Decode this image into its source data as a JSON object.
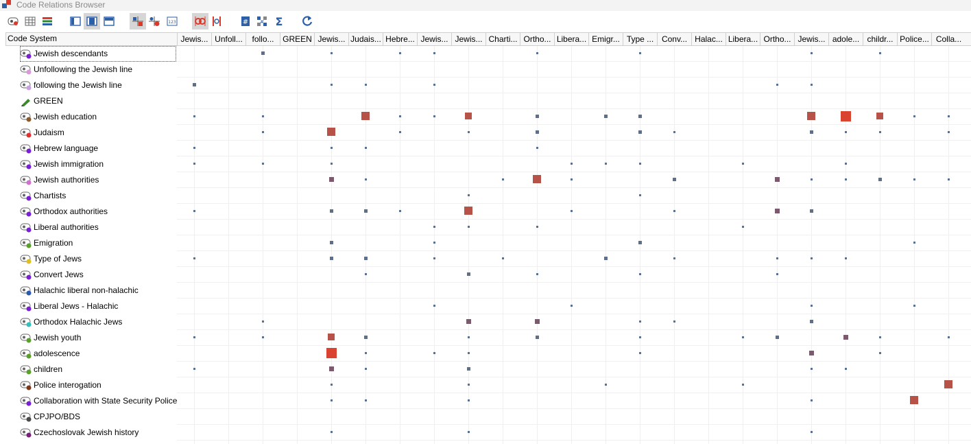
{
  "window": {
    "title": "Code Relations Browser"
  },
  "colors": {
    "small": "#5b6f8e",
    "medium": "#7b5a6e",
    "large": "#b75248",
    "largest": "#d9432f"
  },
  "toolbar": {
    "buttons": [
      {
        "name": "codes-icon",
        "active": false
      },
      {
        "name": "table-icon",
        "active": false
      },
      {
        "name": "list-colors-icon",
        "active": false
      },
      {
        "name": "layout-left-icon",
        "active": false
      },
      {
        "name": "layout-center-icon",
        "active": true
      },
      {
        "name": "layout-top-icon",
        "active": false
      },
      {
        "name": "squares-view-icon",
        "active": true
      },
      {
        "name": "circles-view-icon",
        "active": false
      },
      {
        "name": "numbers-view-icon",
        "active": false
      },
      {
        "name": "intersection-icon",
        "active": true
      },
      {
        "name": "proximity-icon",
        "active": false
      },
      {
        "name": "hash-icon",
        "active": false
      },
      {
        "name": "grid-hash-icon",
        "active": false
      },
      {
        "name": "sigma-icon",
        "active": false
      },
      {
        "name": "refresh-icon",
        "active": false
      }
    ]
  },
  "header": {
    "code_system": "Code System",
    "columns": [
      "Jewis...",
      "Unfoll...",
      "follo...",
      "GREEN",
      "Jewis...",
      "Judais...",
      "Hebre...",
      "Jewis...",
      "Jewis...",
      "Charti...",
      "Ortho...",
      "Libera...",
      "Emigr...",
      "Type ...",
      "Conv...",
      "Halac...",
      "Libera...",
      "Ortho...",
      "Jewis...",
      "adole...",
      "childr...",
      "Police...",
      "Colla..."
    ]
  },
  "rows": [
    {
      "label": "Jewish descendants",
      "dot": "#7a1fd6",
      "icon": "code",
      "cells": {
        "2": 2,
        "4": 1,
        "6": 1,
        "7": 1,
        "10": 1,
        "13": 1,
        "18": 1,
        "20": 1
      }
    },
    {
      "label": "Unfollowing the Jewish line",
      "dot": "#d89ad8",
      "icon": "code",
      "cells": {}
    },
    {
      "label": "following the Jewish line",
      "dot": "#c9a0e0",
      "icon": "code",
      "cells": {
        "0": 2,
        "4": 1,
        "5": 1,
        "7": 1,
        "17": 1,
        "18": 1
      }
    },
    {
      "label": "GREEN",
      "dot": "#3a8a2a",
      "icon": "pencil",
      "cells": {}
    },
    {
      "label": "Jewish education",
      "dot": "#8a5a2a",
      "icon": "code",
      "cells": {
        "0": 1,
        "2": 1,
        "5": "L",
        "6": 1,
        "7": 1,
        "8": "M",
        "10": 2,
        "12": 2,
        "13": 2,
        "18": "L",
        "19": "X",
        "20": "M",
        "21": 1,
        "22": 1
      }
    },
    {
      "label": "Judaism",
      "dot": "#e03030",
      "icon": "code",
      "cells": {
        "2": 1,
        "4": "L",
        "6": 1,
        "8": 1,
        "10": 2,
        "13": 2,
        "14": 1,
        "18": 2,
        "19": 1,
        "20": 1,
        "22": 1
      }
    },
    {
      "label": "Hebrew language",
      "dot": "#7a1fd6",
      "icon": "code",
      "cells": {
        "0": 1,
        "4": 1,
        "5": 1,
        "10": 1
      }
    },
    {
      "label": "Jewish immigration",
      "dot": "#7a1fd6",
      "icon": "code",
      "cells": {
        "0": 1,
        "2": 1,
        "4": 1,
        "11": 1,
        "12": 1,
        "13": 1,
        "16": 1,
        "19": 1
      }
    },
    {
      "label": "Jewish authorities",
      "dot": "#d070d0",
      "icon": "code",
      "cells": {
        "4": "S",
        "5": 1,
        "9": 1,
        "10": "L",
        "11": 1,
        "14": 2,
        "17": "S",
        "18": 1,
        "19": 1,
        "20": 2,
        "21": 1,
        "22": 1
      }
    },
    {
      "label": "Chartists",
      "dot": "#7a1fd6",
      "icon": "code",
      "cells": {
        "8": 1,
        "13": 1
      }
    },
    {
      "label": "Orthodox authorities",
      "dot": "#7a1fd6",
      "icon": "code",
      "cells": {
        "0": 1,
        "4": 2,
        "5": 2,
        "6": 1,
        "8": "L",
        "11": 1,
        "14": 1,
        "17": "S",
        "18": 2
      }
    },
    {
      "label": "Liberal authorities",
      "dot": "#7a1fd6",
      "icon": "code",
      "cells": {
        "7": 1,
        "8": 1,
        "10": 1,
        "16": 1
      }
    },
    {
      "label": "Emigration",
      "dot": "#5aa02a",
      "icon": "code",
      "cells": {
        "4": 2,
        "7": 1,
        "13": 2,
        "21": 1
      }
    },
    {
      "label": "Type of Jews",
      "dot": "#e0c020",
      "icon": "code",
      "cells": {
        "0": 1,
        "4": 2,
        "5": 2,
        "7": 1,
        "9": 1,
        "12": 2,
        "14": 1,
        "17": 1,
        "18": 1,
        "19": 1
      }
    },
    {
      "label": "Convert Jews",
      "dot": "#7a1fd6",
      "icon": "code",
      "cells": {
        "5": 1,
        "8": 2,
        "10": 1,
        "13": 1,
        "17": 1
      }
    },
    {
      "label": "Halachic liberal non-halachic",
      "dot": "#2a5ab0",
      "icon": "code",
      "cells": {}
    },
    {
      "label": "Liberal Jews - Halachic",
      "dot": "#7a1fd6",
      "icon": "code",
      "cells": {
        "7": 1,
        "11": 1,
        "18": 1,
        "21": 1
      }
    },
    {
      "label": "Orthodox Halachic Jews",
      "dot": "#30c0c0",
      "icon": "code",
      "cells": {
        "2": 1,
        "8": "S",
        "10": "S",
        "13": 1,
        "14": 1,
        "18": 2
      }
    },
    {
      "label": "Jewish youth",
      "dot": "#5aa02a",
      "icon": "code",
      "cells": {
        "0": 1,
        "2": 1,
        "4": "M",
        "5": 2,
        "8": 1,
        "10": 2,
        "13": 1,
        "16": 1,
        "17": 2,
        "19": "S",
        "20": 1,
        "22": 1
      }
    },
    {
      "label": "adolescence",
      "dot": "#5aa02a",
      "icon": "code",
      "cells": {
        "4": "X",
        "5": 1,
        "7": 1,
        "8": 1,
        "13": 1,
        "18": "S",
        "20": 1
      }
    },
    {
      "label": "children",
      "dot": "#5aa02a",
      "icon": "code",
      "cells": {
        "0": 1,
        "4": "S",
        "5": 1,
        "8": 2,
        "18": 1,
        "19": 1
      }
    },
    {
      "label": "Police interogation",
      "dot": "#7a3a1a",
      "icon": "code",
      "cells": {
        "4": 1,
        "8": 1,
        "12": 1,
        "16": 1,
        "22": "L"
      }
    },
    {
      "label": "Collaboration with State Security Police",
      "dot": "#7a1fd6",
      "icon": "code",
      "cells": {
        "4": 1,
        "5": 1,
        "8": 1,
        "18": 1,
        "21": "L"
      }
    },
    {
      "label": "CPJPO/BDS",
      "dot": "#4a4a4a",
      "icon": "code",
      "cells": {}
    },
    {
      "label": "Czechoslovak Jewish history",
      "dot": "#7a1f7a",
      "icon": "code",
      "cells": {
        "4": 1,
        "8": 1,
        "18": 1
      }
    }
  ]
}
